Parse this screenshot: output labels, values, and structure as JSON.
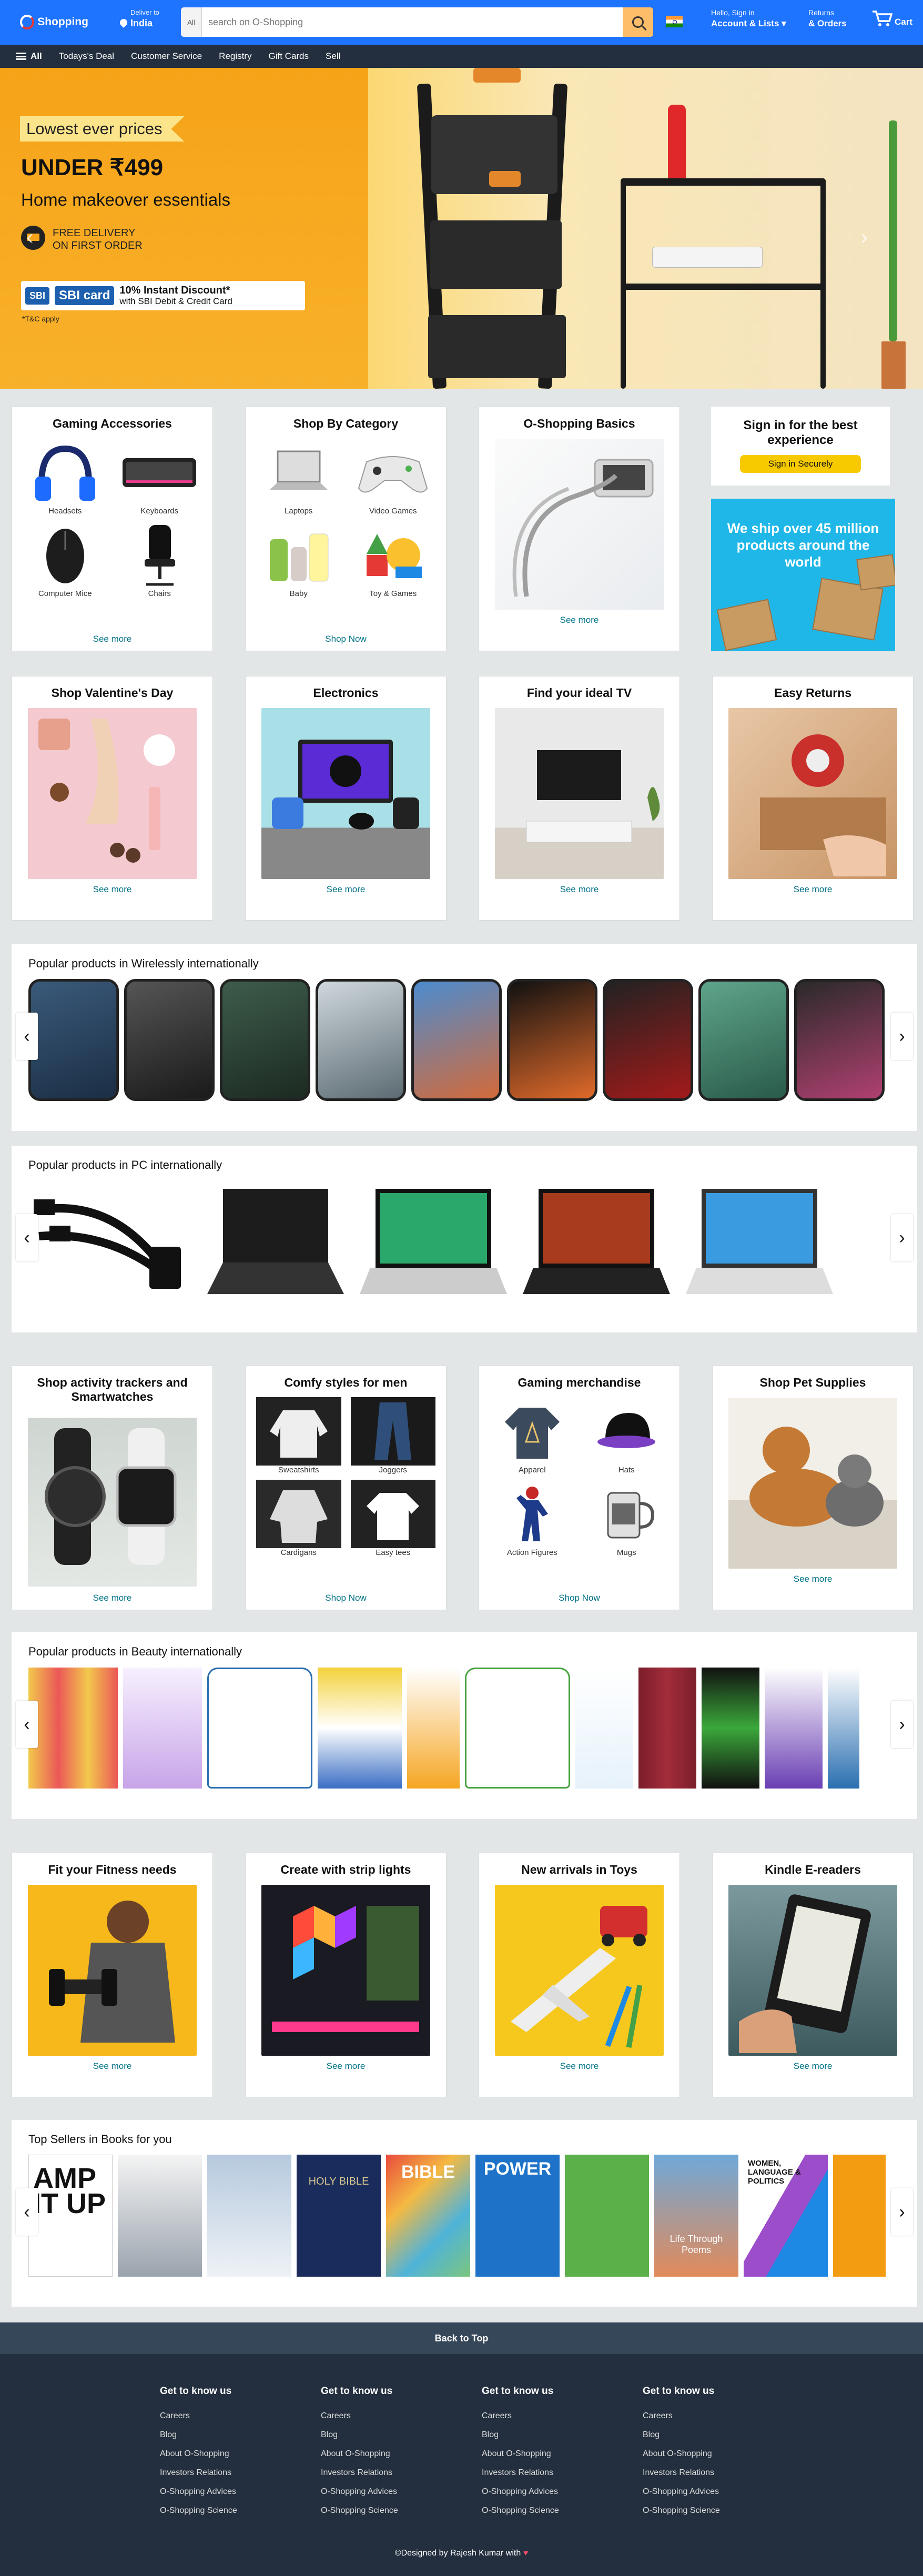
{
  "header": {
    "logo_text": "Shopping",
    "deliver_line1": "Deliver to",
    "deliver_line2": "India",
    "search_category": "All",
    "search_placeholder": "search on O-Shopping",
    "account_line1": "Hello, Sign in",
    "account_line2": "Account & Lists",
    "returns_line1": "Returns",
    "returns_line2": "& Orders",
    "cart_label": "Cart"
  },
  "subnav": {
    "all_label": "All",
    "items": [
      "Todays's Deal",
      "Customer Service",
      "Registry",
      "Gift Cards",
      "Sell"
    ]
  },
  "hero": {
    "badge": "Lowest ever prices",
    "headline": "UNDER ₹499",
    "subhead": "Home makeover essentials",
    "delivery_line1": "FREE DELIVERY",
    "delivery_line2": "ON FIRST ORDER",
    "bank1": "SBI",
    "bank2": "SBI card",
    "offer_bold": "10% Instant Discount*",
    "offer_text": "with SBI Debit & Credit Card",
    "tc": "*T&C apply",
    "prev": "‹",
    "next": "›"
  },
  "row1": {
    "gaming": {
      "title": "Gaming Accessories",
      "items": [
        "Headsets",
        "Keyboards",
        "Computer Mice",
        "Chairs"
      ],
      "more": "See more"
    },
    "category": {
      "title": "Shop By Category",
      "items": [
        "Laptops",
        "Video Games",
        "Baby",
        "Toy & Games"
      ],
      "more": "Shop Now"
    },
    "basics": {
      "title": "O-Shopping Basics",
      "more": "See more"
    },
    "signin": {
      "title": "Sign in for the best experience",
      "button": "Sign in Securely"
    },
    "ship": {
      "text": "We ship over 45 million products around the world"
    }
  },
  "row2": [
    {
      "title": "Shop Valentine's Day",
      "more": "See more"
    },
    {
      "title": "Electronics",
      "more": "See more"
    },
    {
      "title": "Find your ideal TV",
      "more": "See more"
    },
    {
      "title": "Easy Returns",
      "more": "See more"
    }
  ],
  "strip_wireless": {
    "title": "Popular products in Wirelessly internationally"
  },
  "strip_pc": {
    "title": "Popular products in PC internationally"
  },
  "row3": {
    "trackers": {
      "title": "Shop activity trackers and Smartwatches",
      "more": "See more"
    },
    "men": {
      "title": "Comfy styles for men",
      "items": [
        "Sweatshirts",
        "Joggers",
        "Cardigans",
        "Easy tees"
      ],
      "more": "Shop Now"
    },
    "merch": {
      "title": "Gaming merchandise",
      "items": [
        "Apparel",
        "Hats",
        "Action Figures",
        "Mugs"
      ],
      "more": "Shop Now"
    },
    "pets": {
      "title": "Shop Pet Supplies",
      "more": "See more"
    }
  },
  "strip_beauty": {
    "title": "Popular products in Beauty internationally"
  },
  "row4": [
    {
      "title": "Fit your Fitness needs",
      "more": "See more"
    },
    {
      "title": "Create with strip lights",
      "more": "See more"
    },
    {
      "title": "New arrivals in Toys",
      "more": "See more"
    },
    {
      "title": "Kindle E-readers",
      "more": "See more"
    }
  ],
  "strip_books": {
    "title": "Top Sellers in Books for you",
    "covers": [
      "AMP IT UP",
      "POWER",
      "HOLY BIBLE",
      "BIBLE",
      "Life Through Poems",
      "WOMEN, LANGUAGE & POLITICS"
    ]
  },
  "footer": {
    "back_to_top": "Back to Top",
    "columns": [
      {
        "title": "Get to know us",
        "links": [
          "Careers",
          "Blog",
          "About O-Shopping",
          "Investors Relations",
          "O-Shopping Advices",
          "O-Shopping Science"
        ]
      },
      {
        "title": "Get to know us",
        "links": [
          "Careers",
          "Blog",
          "About O-Shopping",
          "Investors Relations",
          "O-Shopping Advices",
          "O-Shopping Science"
        ]
      },
      {
        "title": "Get to know us",
        "links": [
          "Careers",
          "Blog",
          "About O-Shopping",
          "Investors Relations",
          "O-Shopping Advices",
          "O-Shopping Science"
        ]
      },
      {
        "title": "Get to know us",
        "links": [
          "Careers",
          "Blog",
          "About O-Shopping",
          "Investors Relations",
          "O-Shopping Advices",
          "O-Shopping Science"
        ]
      }
    ],
    "credit_prefix": "©Designed by Rajesh Kumar with",
    "heart": "♥"
  },
  "colors": {
    "nav": "#1e73ff",
    "subnav": "#232f3e",
    "accent": "#febd69",
    "link": "#007185",
    "footer": "#232f3e"
  }
}
